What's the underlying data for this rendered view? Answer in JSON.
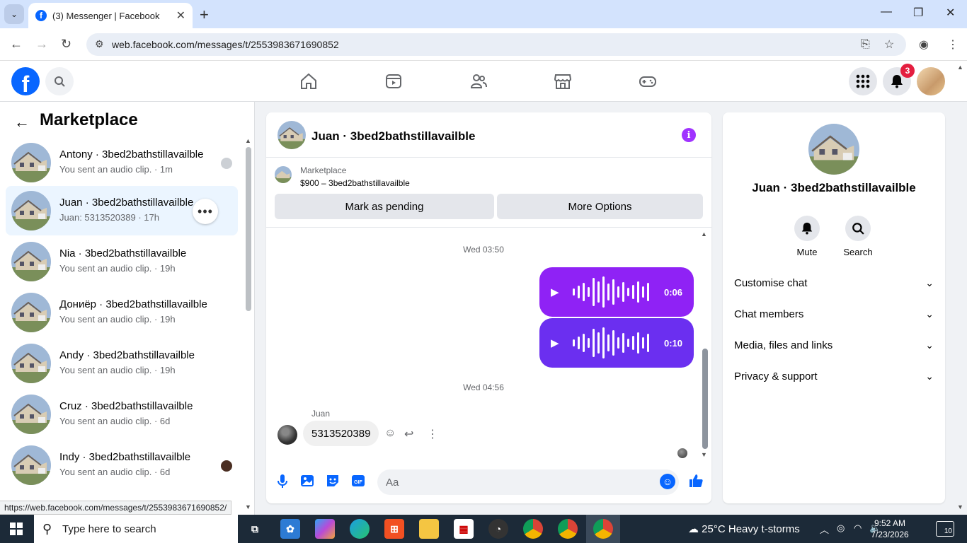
{
  "browser": {
    "tab_title": "(3) Messenger | Facebook",
    "url": "web.facebook.com/messages/t/2553983671690852",
    "status_url": "https://web.facebook.com/messages/t/2553983671690852/"
  },
  "header": {
    "notifications_count": "3"
  },
  "left": {
    "title": "Marketplace",
    "conversations": [
      {
        "name": "Antony · 3bed2bathstillavailble",
        "sub": "You sent an audio clip. · 1m"
      },
      {
        "name": "Juan · 3bed2bathstillavailble",
        "sub": "Juan: 5313520389 · 17h"
      },
      {
        "name": "Nia · 3bed2bathstillavailble",
        "sub": "You sent an audio clip. · 19h"
      },
      {
        "name": "Дониёр · 3bed2bathstillavailble",
        "sub": "You sent an audio clip. · 19h"
      },
      {
        "name": "Andy · 3bed2bathstillavailble",
        "sub": "You sent an audio clip. · 19h"
      },
      {
        "name": "Cruz · 3bed2bathstillavailble",
        "sub": "You sent an audio clip. · 6d"
      },
      {
        "name": "Indy · 3bed2bathstillavailble",
        "sub": "You sent an audio clip. · 6d"
      }
    ]
  },
  "chat": {
    "title": "Juan · 3bed2bathstillavailble",
    "marketplace_label": "Marketplace",
    "listing": "$900 – 3bed2bathstillavailble",
    "mark_pending": "Mark as pending",
    "more_options": "More Options",
    "timestamp1": "Wed 03:50",
    "audio1_duration": "0:06",
    "audio2_duration": "0:10",
    "timestamp2": "Wed 04:56",
    "sender": "Juan",
    "message": "5313520389",
    "composer_placeholder": "Aa",
    "accent_color": "#a033ff"
  },
  "right": {
    "name": "Juan · 3bed2bathstillavailble",
    "mute": "Mute",
    "search": "Search",
    "sections": [
      "Customise chat",
      "Chat members",
      "Media, files and links",
      "Privacy & support"
    ]
  },
  "taskbar": {
    "search_placeholder": "Type here to search",
    "weather": "25°C  Heavy t-storms",
    "time": "9:52 AM",
    "date": "7/23/2026",
    "notifications": "10"
  }
}
